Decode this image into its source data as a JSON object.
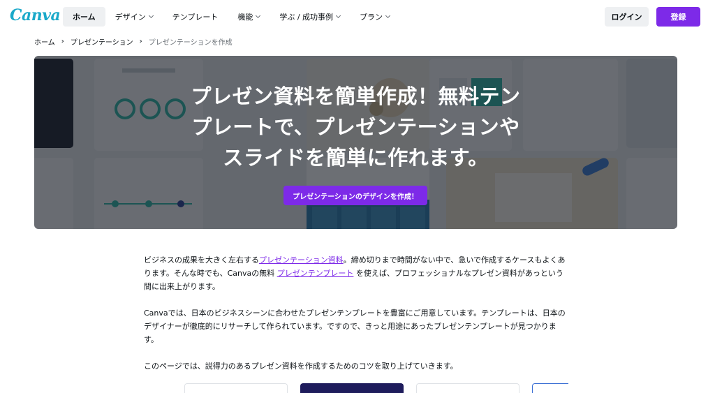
{
  "logo": "Canva",
  "nav": {
    "items": [
      {
        "label": "ホーム",
        "active": true,
        "dropdown": false
      },
      {
        "label": "デザイン",
        "active": false,
        "dropdown": true
      },
      {
        "label": "テンプレート",
        "active": false,
        "dropdown": false
      },
      {
        "label": "機能",
        "active": false,
        "dropdown": true
      },
      {
        "label": "学ぶ / 成功事例",
        "active": false,
        "dropdown": true
      },
      {
        "label": "プラン",
        "active": false,
        "dropdown": true
      }
    ],
    "login": "ログイン",
    "signup": "登録"
  },
  "breadcrumb": {
    "items": [
      "ホーム",
      "プレゼンテーション"
    ],
    "current": "プレゼンテーションを作成"
  },
  "hero": {
    "title_lines": [
      "プレゼン資料を簡単作成！無料テン",
      "プレートで、プレゼンテーションや",
      "スライドを簡単に作れます。"
    ],
    "cta": "プレゼンテーションのデザインを作成！"
  },
  "body": {
    "p1_before": "ビジネスの成果を大きく左右する",
    "p1_link1": "プレゼンテーション資料",
    "p1_middle": "。締め切りまで時間がない中で、急いで作成するケースもよくあります。そんな時でも、Canvaの無料 ",
    "p1_link2": "プレゼンテンプレート",
    "p1_after": " を使えば、プロフェッショナルなプレゼン資料があっという間に出来上がります。",
    "p2": "Canvaでは、日本のビジネスシーンに合わせたプレゼンテンプレートを豊富にご用意しています。テンプレートは、日本のデザイナーが徹底的にリサーチして作られています。ですので、きっと用途にあったプレゼンテンプレートが見つかります。",
    "p3": "このページでは、説得力のあるプレゼン資料を作成するためのコツを取り上げていきます。"
  },
  "colors": {
    "brand_purple": "#7d2ae8",
    "logo_teal": "#1aa9c9",
    "nav_active_bg": "#eef0f2"
  }
}
